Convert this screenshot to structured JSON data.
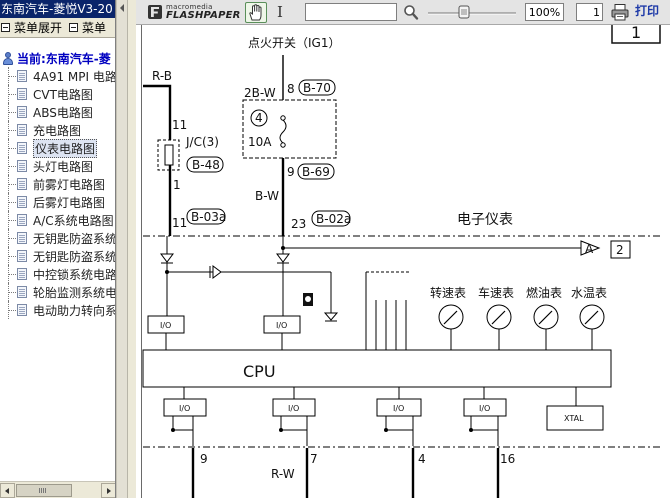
{
  "left_pane": {
    "title": "东南汽车-菱悦V3-20",
    "menu": {
      "expand_label": "菜单展开",
      "collapse_label": "菜单"
    },
    "tree": {
      "root_label": "当前:东南汽车-菱",
      "items": [
        {
          "label": "4A91 MPI 电路",
          "selected": false
        },
        {
          "label": "CVT电路图",
          "selected": false
        },
        {
          "label": "ABS电路图",
          "selected": false
        },
        {
          "label": "充电路图",
          "selected": false
        },
        {
          "label": "仪表电路图",
          "selected": true
        },
        {
          "label": "头灯电路图",
          "selected": false
        },
        {
          "label": "前雾灯电路图",
          "selected": false
        },
        {
          "label": "后雾灯电路图",
          "selected": false
        },
        {
          "label": "A/C系统电路图",
          "selected": false
        },
        {
          "label": "无钥匙防盗系统",
          "selected": false
        },
        {
          "label": "无钥匙防盗系统",
          "selected": false
        },
        {
          "label": "中控锁系统电路",
          "selected": false
        },
        {
          "label": "轮胎监测系统电",
          "selected": false
        },
        {
          "label": "电动助力转向系",
          "selected": false
        }
      ]
    }
  },
  "toolbar": {
    "logo_small": "macromedia",
    "logo_big": "FLASHPAPER",
    "search_value": "",
    "zoom_value": "100%",
    "zoom_level": 0.4,
    "page_value": "1",
    "print_label": "打印",
    "icons": {
      "hand": "hand-icon",
      "text_select": "text-cursor-icon",
      "search": "magnifier-icon",
      "print": "printer-icon"
    }
  },
  "diagram": {
    "page_marker": "1",
    "ignition_label": "点火开关（IG1）",
    "wire_rb": "R-B",
    "wire_2bw": "2B-W",
    "pin_8": "8",
    "conn_b70": "B-70",
    "fuse_number": "4",
    "fuse_rating": "10A",
    "pin_9": "9",
    "conn_b69": "B-69",
    "wire_bw": "B-W",
    "pin_23": "23",
    "conn_b02a": "B-02a",
    "jc_label": "J/C(3)",
    "conn_b48": "B-48",
    "pin_11_top": "11",
    "pin_1": "1",
    "pin_11_bottom": "11",
    "conn_b03a": "B-03a",
    "instrument_label": "电子仪表",
    "arrow_label": "A",
    "arrow_page": "2",
    "gauges": [
      "转速表",
      "车速表",
      "燃油表",
      "水温表"
    ],
    "io_label": "I/O",
    "cpu_label": "CPU",
    "xtal_label": "XTAL",
    "pin_9_bottom": "9",
    "pin_7_bottom": "7",
    "pin_4_bottom": "4",
    "pin_16_bottom": "16",
    "wire_rw": "R-W"
  }
}
